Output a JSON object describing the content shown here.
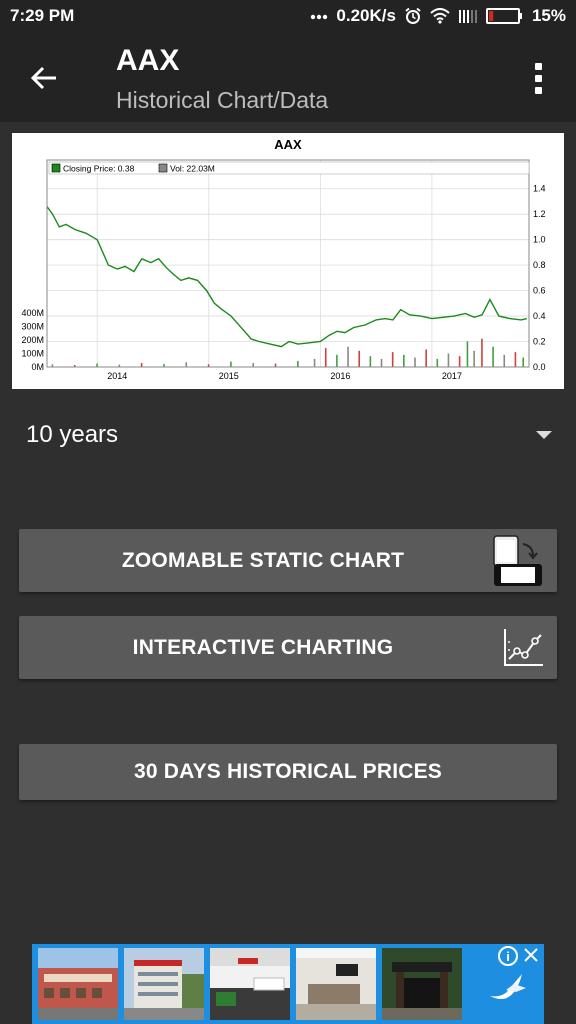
{
  "status_bar": {
    "time": "7:29 PM",
    "network_speed": "0.20K/s",
    "battery": "15%",
    "battery_level": 0.15,
    "icons": [
      "dots-icon",
      "alarm-icon",
      "wifi-icon",
      "signal-icon",
      "battery-icon"
    ]
  },
  "header": {
    "title": "AAX",
    "subtitle": "Historical Chart/Data",
    "back_icon": "arrow-left-icon",
    "menu_icon": "overflow-menu-icon"
  },
  "chart": {
    "title": "AAX",
    "legend": [
      {
        "label": "Closing Price: 0.38",
        "color": "#1a8a1a"
      },
      {
        "label": "Vol: 22.03M",
        "color": "#888888"
      }
    ]
  },
  "chart_data": {
    "type": "line",
    "title": "AAX",
    "x_ticks": [
      "2014",
      "2015",
      "2016",
      "2017"
    ],
    "y_right_ticks": [
      "1.4",
      "1.2",
      "1.0",
      "0.8",
      "0.6",
      "0.4",
      "0.2",
      "0.0"
    ],
    "y_left_ticks": [
      "400M",
      "300M",
      "200M",
      "100M",
      "0M"
    ],
    "ylim_price": [
      0,
      1.5
    ],
    "ylim_volume": [
      0,
      400
    ],
    "grid": true,
    "legend_position": "top-left",
    "series": [
      {
        "name": "Closing Price",
        "color": "#1a8a1a",
        "x": [
          2013.55,
          2013.6,
          2013.66,
          2013.72,
          2013.8,
          2013.9,
          2014.0,
          2014.1,
          2014.18,
          2014.25,
          2014.33,
          2014.4,
          2014.48,
          2014.55,
          2014.62,
          2014.68,
          2014.75,
          2014.82,
          2014.9,
          2014.98,
          2015.05,
          2015.12,
          2015.2,
          2015.3,
          2015.38,
          2015.45,
          2015.55,
          2015.65,
          2015.72,
          2015.8,
          2015.9,
          2016.0,
          2016.08,
          2016.15,
          2016.22,
          2016.3,
          2016.4,
          2016.5,
          2016.58,
          2016.65,
          2016.72,
          2016.8,
          2016.9,
          2017.0,
          2017.1,
          2017.2,
          2017.3,
          2017.38,
          2017.45,
          2017.52,
          2017.6,
          2017.7,
          2017.8,
          2017.85
        ],
        "values": [
          1.26,
          1.2,
          1.1,
          1.12,
          1.08,
          1.05,
          1.0,
          0.8,
          0.77,
          0.79,
          0.75,
          0.85,
          0.82,
          0.85,
          0.78,
          0.73,
          0.68,
          0.7,
          0.68,
          0.6,
          0.5,
          0.45,
          0.4,
          0.3,
          0.22,
          0.2,
          0.18,
          0.16,
          0.2,
          0.18,
          0.19,
          0.2,
          0.25,
          0.28,
          0.27,
          0.31,
          0.33,
          0.37,
          0.38,
          0.37,
          0.45,
          0.41,
          0.4,
          0.38,
          0.39,
          0.4,
          0.42,
          0.39,
          0.41,
          0.53,
          0.4,
          0.38,
          0.37,
          0.38
        ]
      },
      {
        "name": "Vol",
        "color": "#888888",
        "x": [
          2013.6,
          2013.8,
          2014.0,
          2014.2,
          2014.4,
          2014.6,
          2014.8,
          2015.0,
          2015.2,
          2015.4,
          2015.6,
          2015.8,
          2015.95,
          2016.05,
          2016.15,
          2016.25,
          2016.35,
          2016.45,
          2016.55,
          2016.65,
          2016.75,
          2016.85,
          2016.95,
          2017.05,
          2017.15,
          2017.25,
          2017.32,
          2017.38,
          2017.45,
          2017.55,
          2017.65,
          2017.75,
          2017.82
        ],
        "values": [
          20,
          15,
          25,
          18,
          30,
          22,
          35,
          20,
          40,
          30,
          25,
          45,
          60,
          140,
          90,
          150,
          120,
          80,
          60,
          110,
          90,
          70,
          130,
          60,
          100,
          80,
          190,
          120,
          210,
          150,
          90,
          110,
          70
        ]
      }
    ]
  },
  "range_select": {
    "value": "10 years"
  },
  "buttons": {
    "zoomable": "ZOOMABLE STATIC CHART",
    "interactive": "INTERACTIVE CHARTING",
    "thirty_days": "30 DAYS HISTORICAL PRICES"
  },
  "ad": {
    "info_icon": "info-icon",
    "close_icon": "close-icon",
    "brand_icon": "bird-icon",
    "colors": {
      "background": "#1e8fe0"
    }
  }
}
